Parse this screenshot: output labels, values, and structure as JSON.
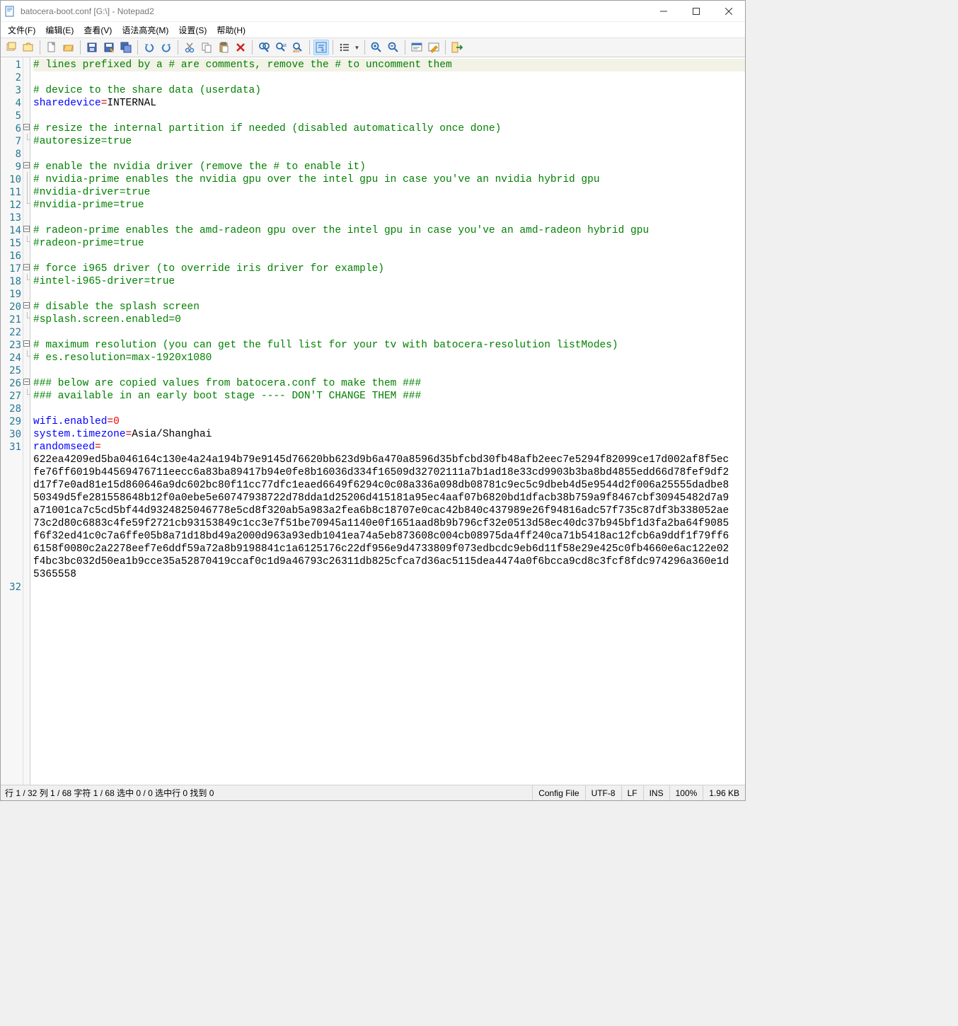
{
  "title": "batocera-boot.conf [G:\\] - Notepad2",
  "menu": {
    "file": "文件(F)",
    "edit": "编辑(E)",
    "view": "查看(V)",
    "syntax": "语法高亮(M)",
    "settings": "设置(S)",
    "help": "帮助(H)"
  },
  "toolbar_icons": [
    "new-window",
    "open-recent",
    "sep",
    "new-file",
    "open-file",
    "sep",
    "save",
    "save-as",
    "save-copy",
    "sep",
    "undo",
    "redo",
    "sep",
    "cut",
    "copy",
    "paste",
    "delete",
    "sep",
    "find",
    "find-prev-next",
    "replace",
    "sep",
    "word-wrap",
    "sep",
    "bullets-dd",
    "sep",
    "zoom-in",
    "zoom-out",
    "sep",
    "scheme",
    "customize",
    "sep",
    "exit"
  ],
  "lines": [
    {
      "n": 1,
      "fold": "",
      "seg": [
        [
          "comment",
          "# lines prefixed by a # are comments, remove the # to uncomment them"
        ]
      ],
      "hl": true
    },
    {
      "n": 2,
      "fold": "",
      "seg": []
    },
    {
      "n": 3,
      "fold": "",
      "seg": [
        [
          "comment",
          "# device to the share data (userdata)"
        ]
      ]
    },
    {
      "n": 4,
      "fold": "",
      "seg": [
        [
          "key",
          "sharedevice"
        ],
        [
          "op",
          "="
        ],
        [
          "val-str",
          "INTERNAL"
        ]
      ]
    },
    {
      "n": 5,
      "fold": "",
      "seg": []
    },
    {
      "n": 6,
      "fold": "box",
      "seg": [
        [
          "comment",
          "# resize the internal partition if needed (disabled automatically once done)"
        ]
      ]
    },
    {
      "n": 7,
      "fold": "end",
      "seg": [
        [
          "comment",
          "#autoresize=true"
        ]
      ]
    },
    {
      "n": 8,
      "fold": "",
      "seg": []
    },
    {
      "n": 9,
      "fold": "box",
      "seg": [
        [
          "comment",
          "# enable the nvidia driver (remove the # to enable it)"
        ]
      ]
    },
    {
      "n": 10,
      "fold": "mid",
      "seg": [
        [
          "comment",
          "# nvidia-prime enables the nvidia gpu over the intel gpu in case you've an nvidia hybrid gpu"
        ]
      ]
    },
    {
      "n": 11,
      "fold": "mid",
      "seg": [
        [
          "comment",
          "#nvidia-driver=true"
        ]
      ]
    },
    {
      "n": 12,
      "fold": "end",
      "seg": [
        [
          "comment",
          "#nvidia-prime=true"
        ]
      ]
    },
    {
      "n": 13,
      "fold": "",
      "seg": []
    },
    {
      "n": 14,
      "fold": "box",
      "seg": [
        [
          "comment",
          "# radeon-prime enables the amd-radeon gpu over the intel gpu in case you've an amd-radeon hybrid gpu"
        ]
      ]
    },
    {
      "n": 15,
      "fold": "end",
      "seg": [
        [
          "comment",
          "#radeon-prime=true"
        ]
      ]
    },
    {
      "n": 16,
      "fold": "",
      "seg": []
    },
    {
      "n": 17,
      "fold": "box",
      "seg": [
        [
          "comment",
          "# force i965 driver (to override iris driver for example)"
        ]
      ]
    },
    {
      "n": 18,
      "fold": "end",
      "seg": [
        [
          "comment",
          "#intel-i965-driver=true"
        ]
      ]
    },
    {
      "n": 19,
      "fold": "",
      "seg": []
    },
    {
      "n": 20,
      "fold": "box",
      "seg": [
        [
          "comment",
          "# disable the splash screen"
        ]
      ]
    },
    {
      "n": 21,
      "fold": "end",
      "seg": [
        [
          "comment",
          "#splash.screen.enabled=0"
        ]
      ]
    },
    {
      "n": 22,
      "fold": "",
      "seg": []
    },
    {
      "n": 23,
      "fold": "box",
      "seg": [
        [
          "comment",
          "# maximum resolution (you can get the full list for your tv with batocera-resolution listModes)"
        ]
      ]
    },
    {
      "n": 24,
      "fold": "end",
      "seg": [
        [
          "comment",
          "# es.resolution=max-1920x1080"
        ]
      ]
    },
    {
      "n": 25,
      "fold": "",
      "seg": []
    },
    {
      "n": 26,
      "fold": "box",
      "seg": [
        [
          "comment",
          "### below are copied values from batocera.conf to make them ###"
        ]
      ]
    },
    {
      "n": 27,
      "fold": "end",
      "seg": [
        [
          "comment",
          "### available in an early boot stage ---- DON'T CHANGE THEM ###"
        ]
      ]
    },
    {
      "n": 28,
      "fold": "",
      "seg": []
    },
    {
      "n": 29,
      "fold": "",
      "seg": [
        [
          "key",
          "wifi.enabled"
        ],
        [
          "op",
          "="
        ],
        [
          "val-num",
          "0"
        ]
      ]
    },
    {
      "n": 30,
      "fold": "",
      "seg": [
        [
          "key",
          "system.timezone"
        ],
        [
          "op",
          "="
        ],
        [
          "val-str",
          "Asia/Shanghai"
        ]
      ]
    },
    {
      "n": 31,
      "fold": "",
      "seg": [
        [
          "key",
          "randomseed"
        ],
        [
          "op",
          "="
        ]
      ],
      "wrap": "622ea4209ed5ba046164c130e4a24a194b79e9145d76620bb623d9b6a470a8596d35bfcbd30fb48afb2eec7e5294f82099ce17d002af8f5ecfe76ff6019b44569476711eecc6a83ba89417b94e0fe8b16036d334f16509d32702111a7b1ad18e33cd9903b3ba8bd4855edd66d78fef9df2d17f7e0ad81e15d860646a9dc602bc80f11cc77dfc1eaed6649f6294c0c08a336a098db08781c9ec5c9dbeb4d5e9544d2f006a25555dadbe850349d5fe281558648b12f0a0ebe5e60747938722d78dda1d25206d415181a95ec4aaf07b6820bd1dfacb38b759a9f8467cbf30945482d7a9a71001ca7c5cd5bf44d9324825046778e5cd8f320ab5a983a2fea6b8c18707e0cac42b840c437989e26f94816adc57f735c87df3b338052ae73c2d80c6883c4fe59f2721cb93153849c1cc3e7f51be70945a1140e0f1651aad8b9b796cf32e0513d58ec40dc37b945bf1d3fa2ba64f9085f6f32ed41c0c7a6ffe05b8a71d18bd49a2000d963a93edb1041ea74a5eb873608c004cb08975da4ff240ca71b5418ac12fcb6a9ddf1f79ff66158f0080c2a2278eef7e6ddf59a72a8b9198841c1a6125176c22df956e9d4733809f073edbcdc9eb6d11f58e29e425c0fb4660e6ac122e02f4bc3bc032d50ea1b9cce35a52870419ccaf0c1d9a46793c26311db825cfca7d36ac5115dea4474a0f6bcca9cd8c3fcf8fdc974296a360e1d5365558"
    },
    {
      "n": 32,
      "fold": "",
      "seg": []
    }
  ],
  "status": {
    "left": "行 1 / 32  列 1 / 68  字符 1 / 68  选中 0 / 0  选中行 0  找到 0",
    "scheme": "Config File",
    "encoding": "UTF-8",
    "eol": "LF",
    "ovr": "INS",
    "zoom": "100%",
    "size": "1.96 KB"
  }
}
